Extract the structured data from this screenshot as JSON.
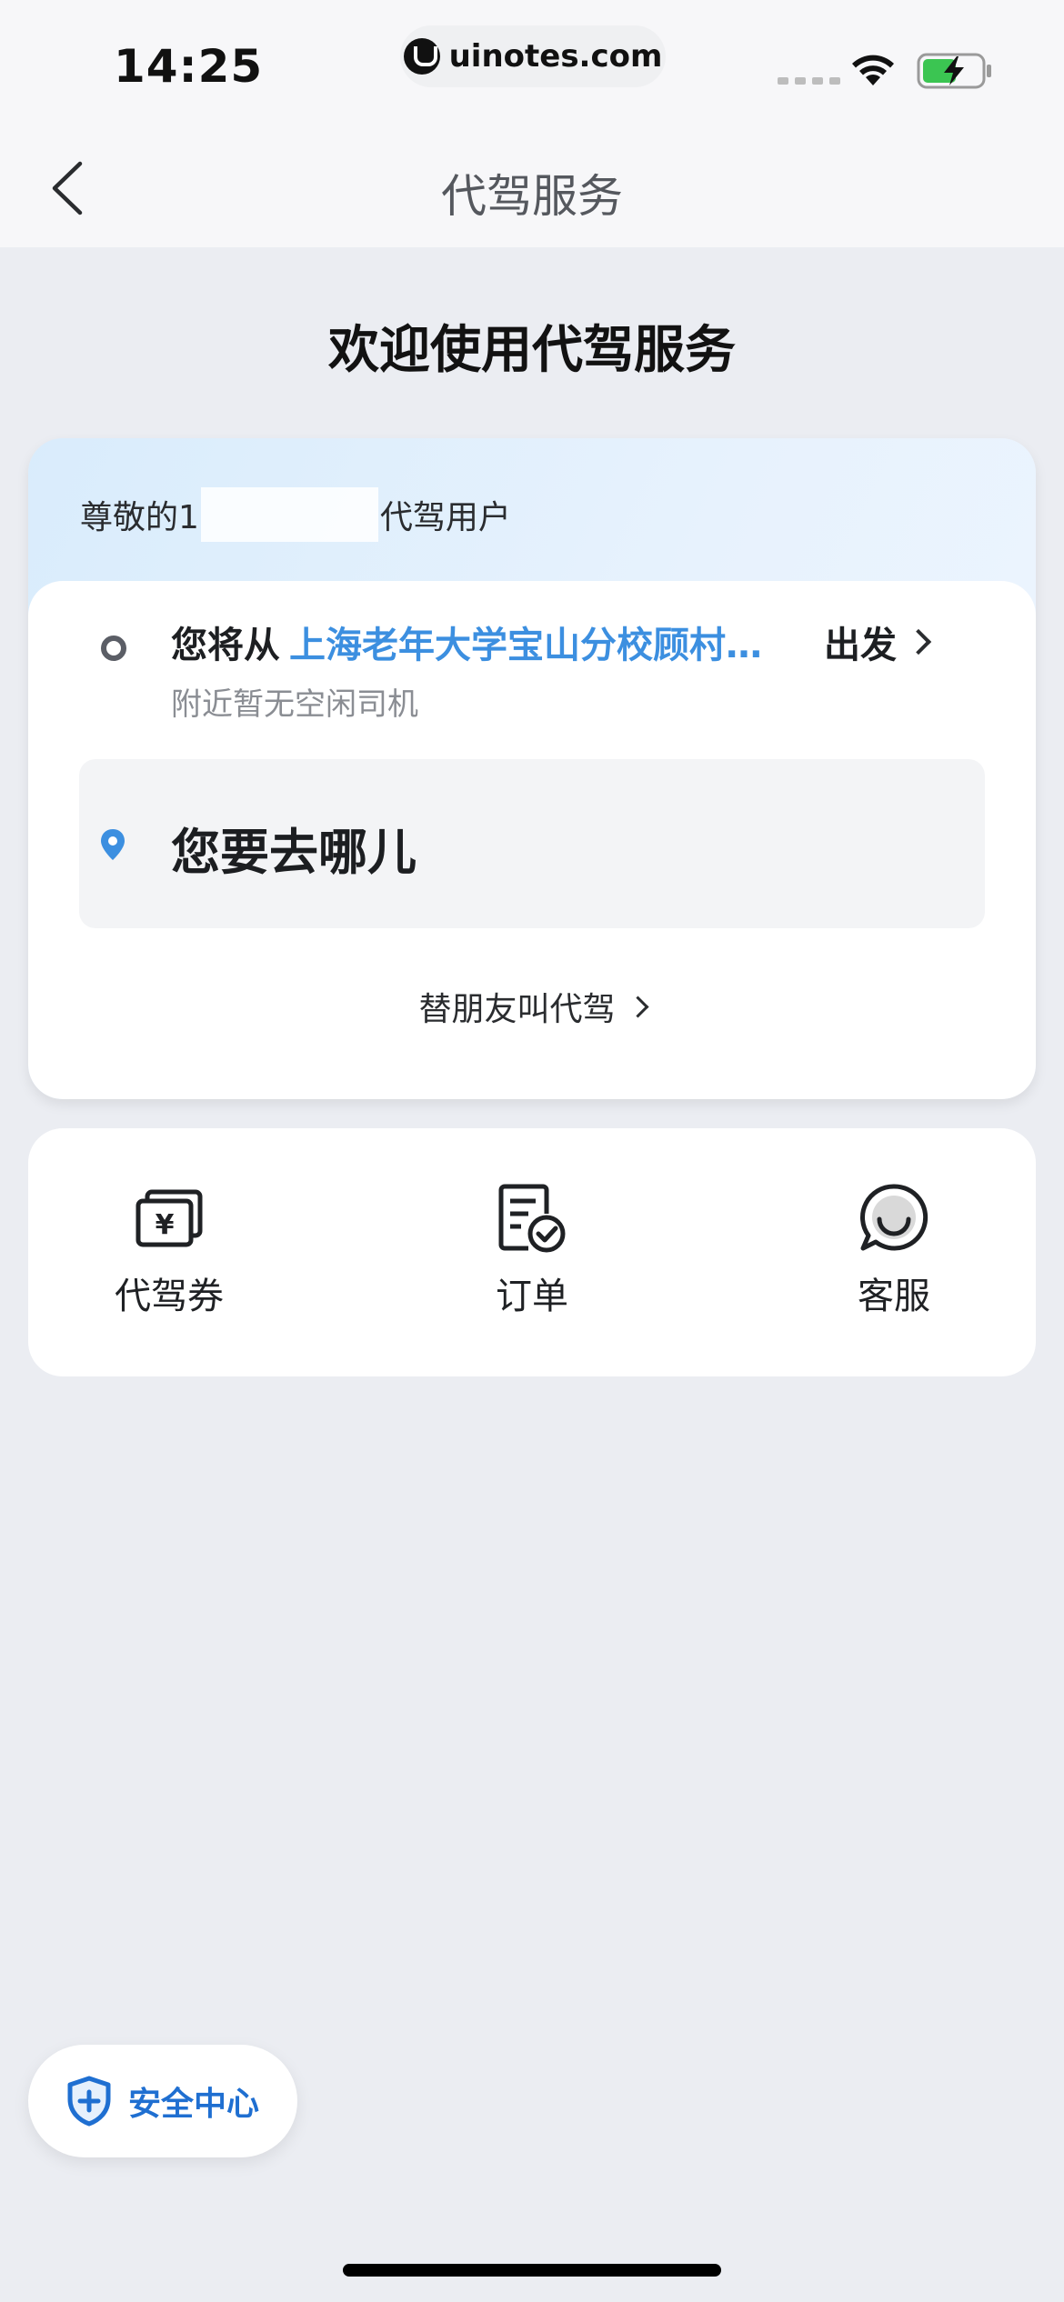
{
  "status_bar": {
    "time": "14:25",
    "url": "uinotes.com"
  },
  "nav": {
    "title": "代驾服务"
  },
  "welcome": {
    "title": "欢迎使用代驾服务"
  },
  "card": {
    "greeting_prefix": "尊敬的1",
    "greeting_suffix": "代驾用户",
    "origin_prefix": "您将从",
    "origin_place": "上海老年大学宝山分校顾村…",
    "depart_label": "出发",
    "origin_note": "附近暂无空闲司机",
    "destination_placeholder": "您要去哪儿",
    "friend_link": "替朋友叫代驾"
  },
  "actions": [
    {
      "label": "代驾券",
      "icon": "coupon-icon"
    },
    {
      "label": "订单",
      "icon": "order-icon"
    },
    {
      "label": "客服",
      "icon": "customer-service-icon"
    }
  ],
  "safety": {
    "label": "安全中心",
    "icon": "shield-plus-icon"
  },
  "colors": {
    "accent_blue": "#3C8FE0",
    "safety_blue": "#1F6FD1",
    "background": "#EBEDF2"
  }
}
